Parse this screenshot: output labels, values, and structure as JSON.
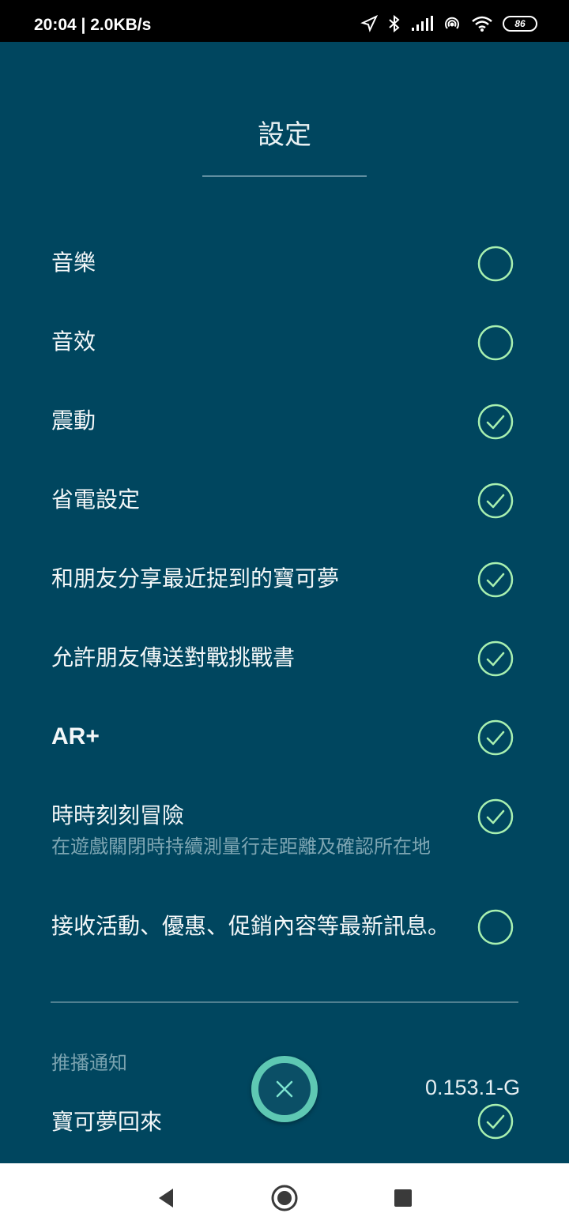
{
  "status_bar": {
    "time_speed": "20:04 | 2.0KB/s",
    "battery": "86",
    "icons": [
      "location-arrow-icon",
      "bluetooth-icon",
      "signal-icon",
      "hotspot-icon",
      "wifi-icon",
      "battery-icon"
    ]
  },
  "page": {
    "title": "設定"
  },
  "settings": [
    {
      "label": "音樂",
      "checked": false
    },
    {
      "label": "音效",
      "checked": false
    },
    {
      "label": "震動",
      "checked": true
    },
    {
      "label": "省電設定",
      "checked": true
    },
    {
      "label": "和朋友分享最近捉到的寶可夢",
      "checked": true
    },
    {
      "label": "允許朋友傳送對戰挑戰書",
      "checked": true
    },
    {
      "label": "AR+",
      "checked": true
    },
    {
      "label": "時時刻刻冒險",
      "sublabel": "在遊戲關閉時持續測量行走距離及確認所在地",
      "checked": true
    },
    {
      "label": "接收活動、優惠、促銷內容等最新訊息。",
      "checked": false
    }
  ],
  "push_section": {
    "heading": "推播通知",
    "items": [
      {
        "label": "寶可夢回來",
        "checked": true
      }
    ]
  },
  "version": "0.153.1-G",
  "colors": {
    "background": "#00465f",
    "check_green": "#a8f0b0",
    "close_ring": "#5ec8b3"
  },
  "nav": {
    "icons": [
      "back-icon",
      "home-icon",
      "recents-icon"
    ]
  }
}
